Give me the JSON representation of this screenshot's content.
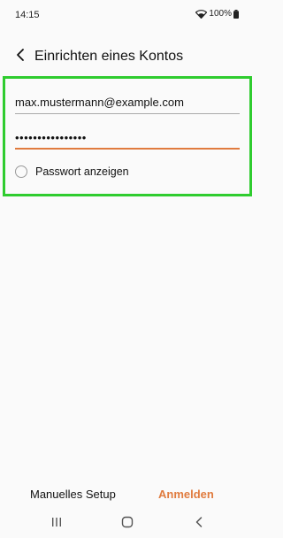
{
  "status": {
    "time": "14:15",
    "battery": "100%",
    "icons": [
      "wifi-icon",
      "battery-icon"
    ]
  },
  "header": {
    "title": "Einrichten eines Kontos",
    "back_icon": "chevron-left-icon"
  },
  "form": {
    "email": "max.mustermann@example.com",
    "password_masked": "••••••••••••••••",
    "show_password_label": "Passwort anzeigen"
  },
  "actions": {
    "manual_setup": "Manuelles Setup",
    "login": "Anmelden"
  },
  "nav": {
    "icons": [
      "recent-apps-icon",
      "home-icon",
      "back-icon"
    ]
  },
  "colors": {
    "accent": "#e07b3e",
    "highlight": "#2fcc2f",
    "background": "#fafafa"
  }
}
